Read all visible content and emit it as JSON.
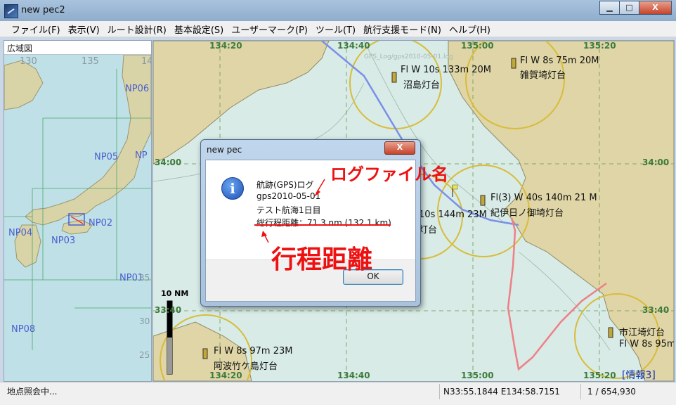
{
  "window": {
    "title": "new pec2",
    "minimize": "▁",
    "maximize": "□",
    "close": "X"
  },
  "menu": [
    "ファイル(F)",
    "表示(V)",
    "ルート設計(R)",
    "基本設定(S)",
    "ユーザーマーク(P)",
    "ツール(T)",
    "航行支援モード(N)",
    "ヘルプ(H)"
  ],
  "overview": {
    "title": "広域図",
    "lon_labels": [
      "130",
      "135",
      "14"
    ],
    "np_labels": [
      "NP06",
      "NP05",
      "NP",
      "NP04",
      "NP02",
      "NP03",
      "NP01",
      "NP08"
    ],
    "side_numbers": [
      "35",
      "30",
      "25"
    ]
  },
  "map": {
    "top_coords": [
      "134:20",
      "134:40",
      "135:00",
      "135:20"
    ],
    "bottom_coords": [
      "134:20",
      "134:40",
      "135:00",
      "135:20"
    ],
    "lat_left": [
      "34:00",
      "33:40"
    ],
    "lat_right": [
      "34:00",
      "33:40"
    ],
    "lighthouses": [
      {
        "spec": "Fl W 10s 133m 20M",
        "name": "沼島灯台"
      },
      {
        "spec": "Fl W 8s 75m 20M",
        "name": "雑賀埼灯台"
      },
      {
        "spec": "Fl(3) W 40s 140m 21 M",
        "name": "紀伊日ノ御埼灯台"
      },
      {
        "spec": "10s 144m 23M",
        "name": "灯台"
      },
      {
        "spec": "Fl W 8s 97m 23M",
        "name": "阿波竹ケ島灯台"
      },
      {
        "spec": "Fl W 8s 95m",
        "name": "市江埼灯台"
      }
    ],
    "scale_bar": "10 NM",
    "info_tag": "[情報3]",
    "faint_text": "GPS_Log/gps2010-05-01.log"
  },
  "dialog": {
    "title": "new pec",
    "close": "X",
    "lines": [
      "航跡(GPS)ログ",
      "gps2010-05-01",
      "テスト航海1日目",
      "総行程距離：71.3 nm (132.1 km)"
    ],
    "ok": "OK"
  },
  "annotations": {
    "logfile": "ログファイル名",
    "distance": "行程距離"
  },
  "status": {
    "left": "地点照会中...",
    "coords": "N33:55.1844 E134:58.7151",
    "scale": "1 / 654,930"
  }
}
